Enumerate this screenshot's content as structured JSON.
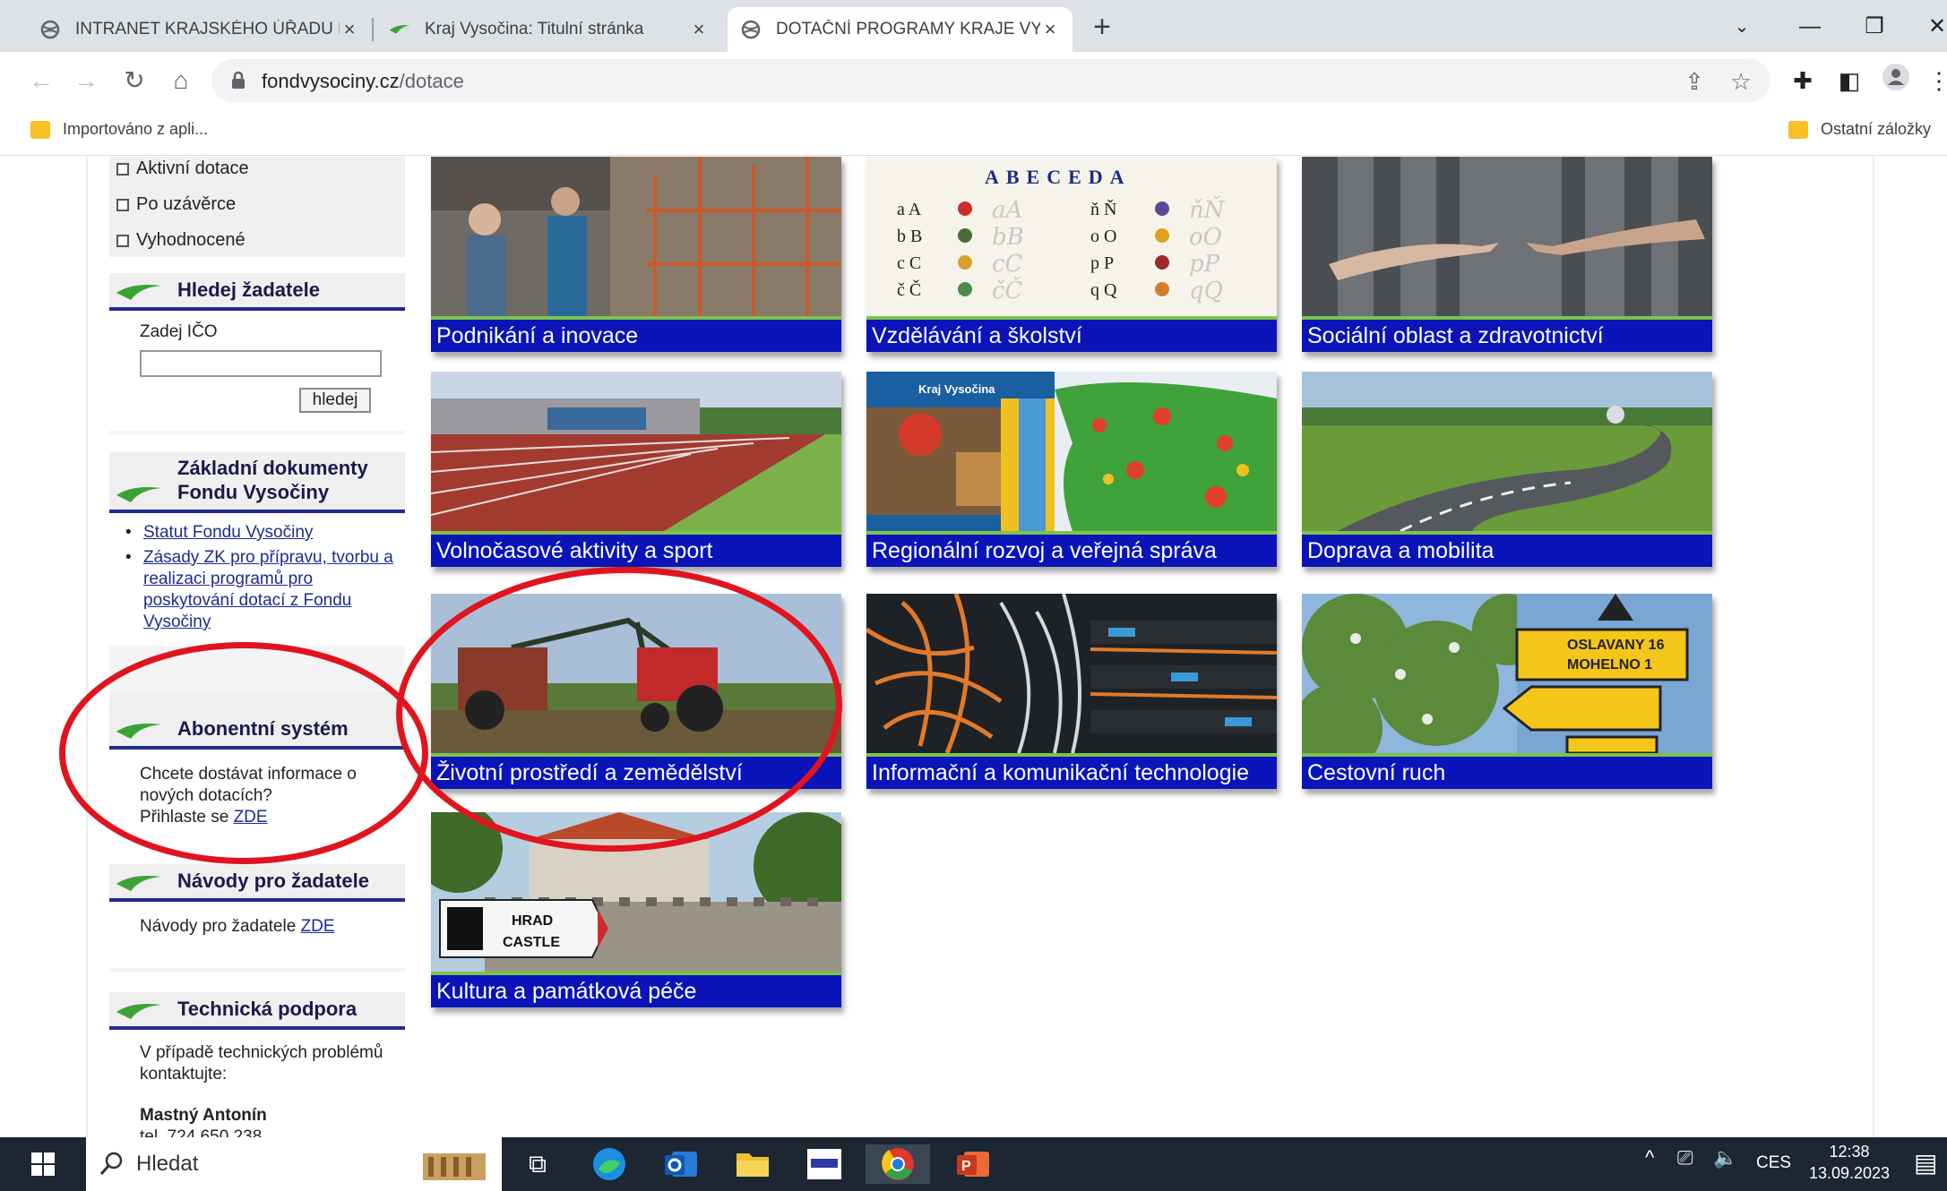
{
  "browser": {
    "tabs": [
      {
        "title": "INTRANET KRAJSKÉHO ÚŘADU K",
        "icon": "globe-icon",
        "active": false
      },
      {
        "title": "Kraj Vysočina: Titulní stránka",
        "icon": "vysocina-swoosh-icon",
        "active": false
      },
      {
        "title": "DOTAČNÍ PROGRAMY KRAJE VYS",
        "icon": "globe-icon",
        "active": true
      }
    ],
    "close_glyph": "×",
    "new_tab_glyph": "+",
    "url_host": "fondvysociny.cz",
    "url_path": "/dotace",
    "bookmarks": [
      {
        "label": "Importováno z apli..."
      },
      {
        "label": "Ostatní záložky"
      }
    ]
  },
  "sidebar": {
    "filters": [
      "Aktivní dotace",
      "Po uzávěrce",
      "Vyhodnocené"
    ],
    "search_applicant": {
      "heading": "Hledej žadatele",
      "label": "Zadej IČO",
      "input_value": "",
      "button": "hledej"
    },
    "documents": {
      "heading_line1": "Základní dokumenty",
      "heading_line2": "Fondu Vysočiny",
      "links": [
        "Statut Fondu Vysočiny",
        "Zásady ZK pro přípravu, tvorbu a realizaci programů pro poskytování dotací z Fondu Vysočiny"
      ]
    },
    "subscription": {
      "heading": "Abonentní systém",
      "text": "Chcete dostávat informace o nových dotacích?",
      "cta_prefix": "Přihlaste se",
      "cta_link": "ZDE"
    },
    "guides": {
      "heading": "Návody pro žadatele",
      "text_prefix": "Návody pro žadatele",
      "link": "ZDE"
    },
    "support": {
      "heading": "Technická podpora",
      "text": "V případě technických problémů kontaktujte:",
      "contact_name": "Mastný Antonín",
      "contact_phone": "tel. 724 650 238"
    }
  },
  "tiles": [
    {
      "label": "Podnikání a inovace"
    },
    {
      "label": "Vzdělávání a školství"
    },
    {
      "label": "Sociální oblast a zdravotnictví"
    },
    {
      "label": "Volnočasové aktivity a sport"
    },
    {
      "label": "Regionální rozvoj a veřejná správa"
    },
    {
      "label": "Doprava a mobilita"
    },
    {
      "label": "Životní prostředí a zemědělství"
    },
    {
      "label": "Informační a komunikační technologie"
    },
    {
      "label": "Cestovní ruch"
    },
    {
      "label": "Kultura a památková péče"
    }
  ],
  "tile_image_text": {
    "abeceda": "ABECEDA",
    "kraj_vysocina": "Kraj Vysočina",
    "sign_top": "OSLAVANY 16",
    "sign_top2": "MOHELNO 1",
    "castle_sign1": "HRAD",
    "castle_sign2": "CASTLE"
  },
  "taskbar": {
    "search_placeholder": "Hledat",
    "language": "CES",
    "time": "12:38",
    "date": "13.09.2023"
  },
  "colors": {
    "tile_bar": "#0a14b8",
    "tile_bar_top": "#7cc44a",
    "sidebar_rule": "#1f2b8f",
    "annotation": "#e0141e"
  }
}
